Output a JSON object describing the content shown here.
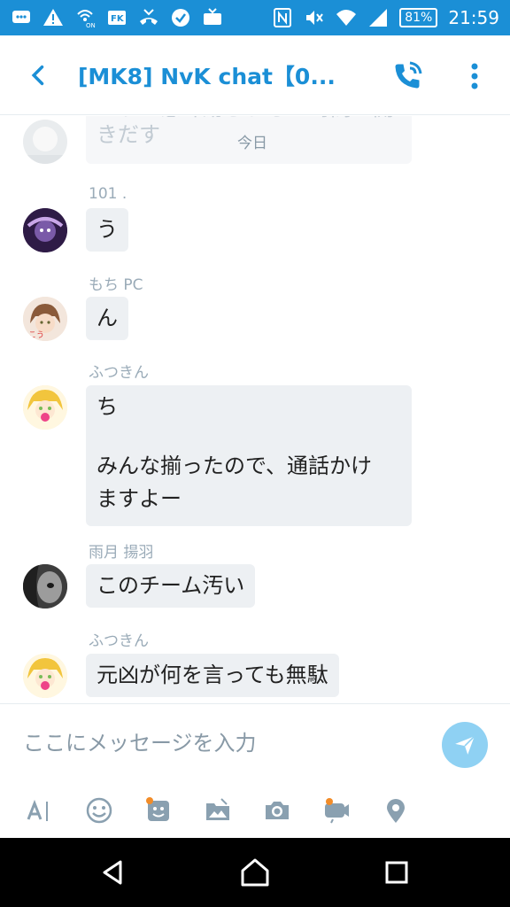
{
  "status_bar": {
    "battery": "81%",
    "time": "21:59",
    "icons": [
      "message-icon",
      "warning-icon",
      "wifi-call-icon",
      "fk-icon",
      "missed-call-icon",
      "check-icon",
      "tv-icon",
      "nfc-icon",
      "mute-icon",
      "wifi-icon",
      "signal-icon"
    ]
  },
  "header": {
    "title": "[MK8] NvK chat【0...",
    "back_icon": "back-arrow-icon",
    "call_icon": "phone-call-icon",
    "menu_icon": "more-vertical-icon"
  },
  "chat": {
    "date_separator": "今日",
    "faded_previous": "こうと意味紛らわしい時間に開きだす",
    "messages": [
      {
        "sender": "101 .",
        "text": "う"
      },
      {
        "sender": "もち PC",
        "text": "ん"
      },
      {
        "sender": "ふつきん",
        "line1": "ち",
        "line2": "みんな揃ったので、通話かけ",
        "line3": "ますよー"
      },
      {
        "sender": "雨月 揚羽",
        "text": "このチーム汚い"
      },
      {
        "sender": "ふつきん",
        "text": "元凶が何を言っても無駄"
      }
    ]
  },
  "composer": {
    "placeholder": "ここにメッセージを入力",
    "send_icon": "send-icon",
    "tools": [
      "text-format-icon",
      "emoji-icon",
      "sticker-icon",
      "gallery-icon",
      "camera-icon",
      "video-icon",
      "location-icon"
    ]
  },
  "colors": {
    "primary": "#1b8fd6",
    "bubble": "#edf0f3",
    "send_button": "#8fd1f3",
    "sender_name": "#9aabb8"
  }
}
